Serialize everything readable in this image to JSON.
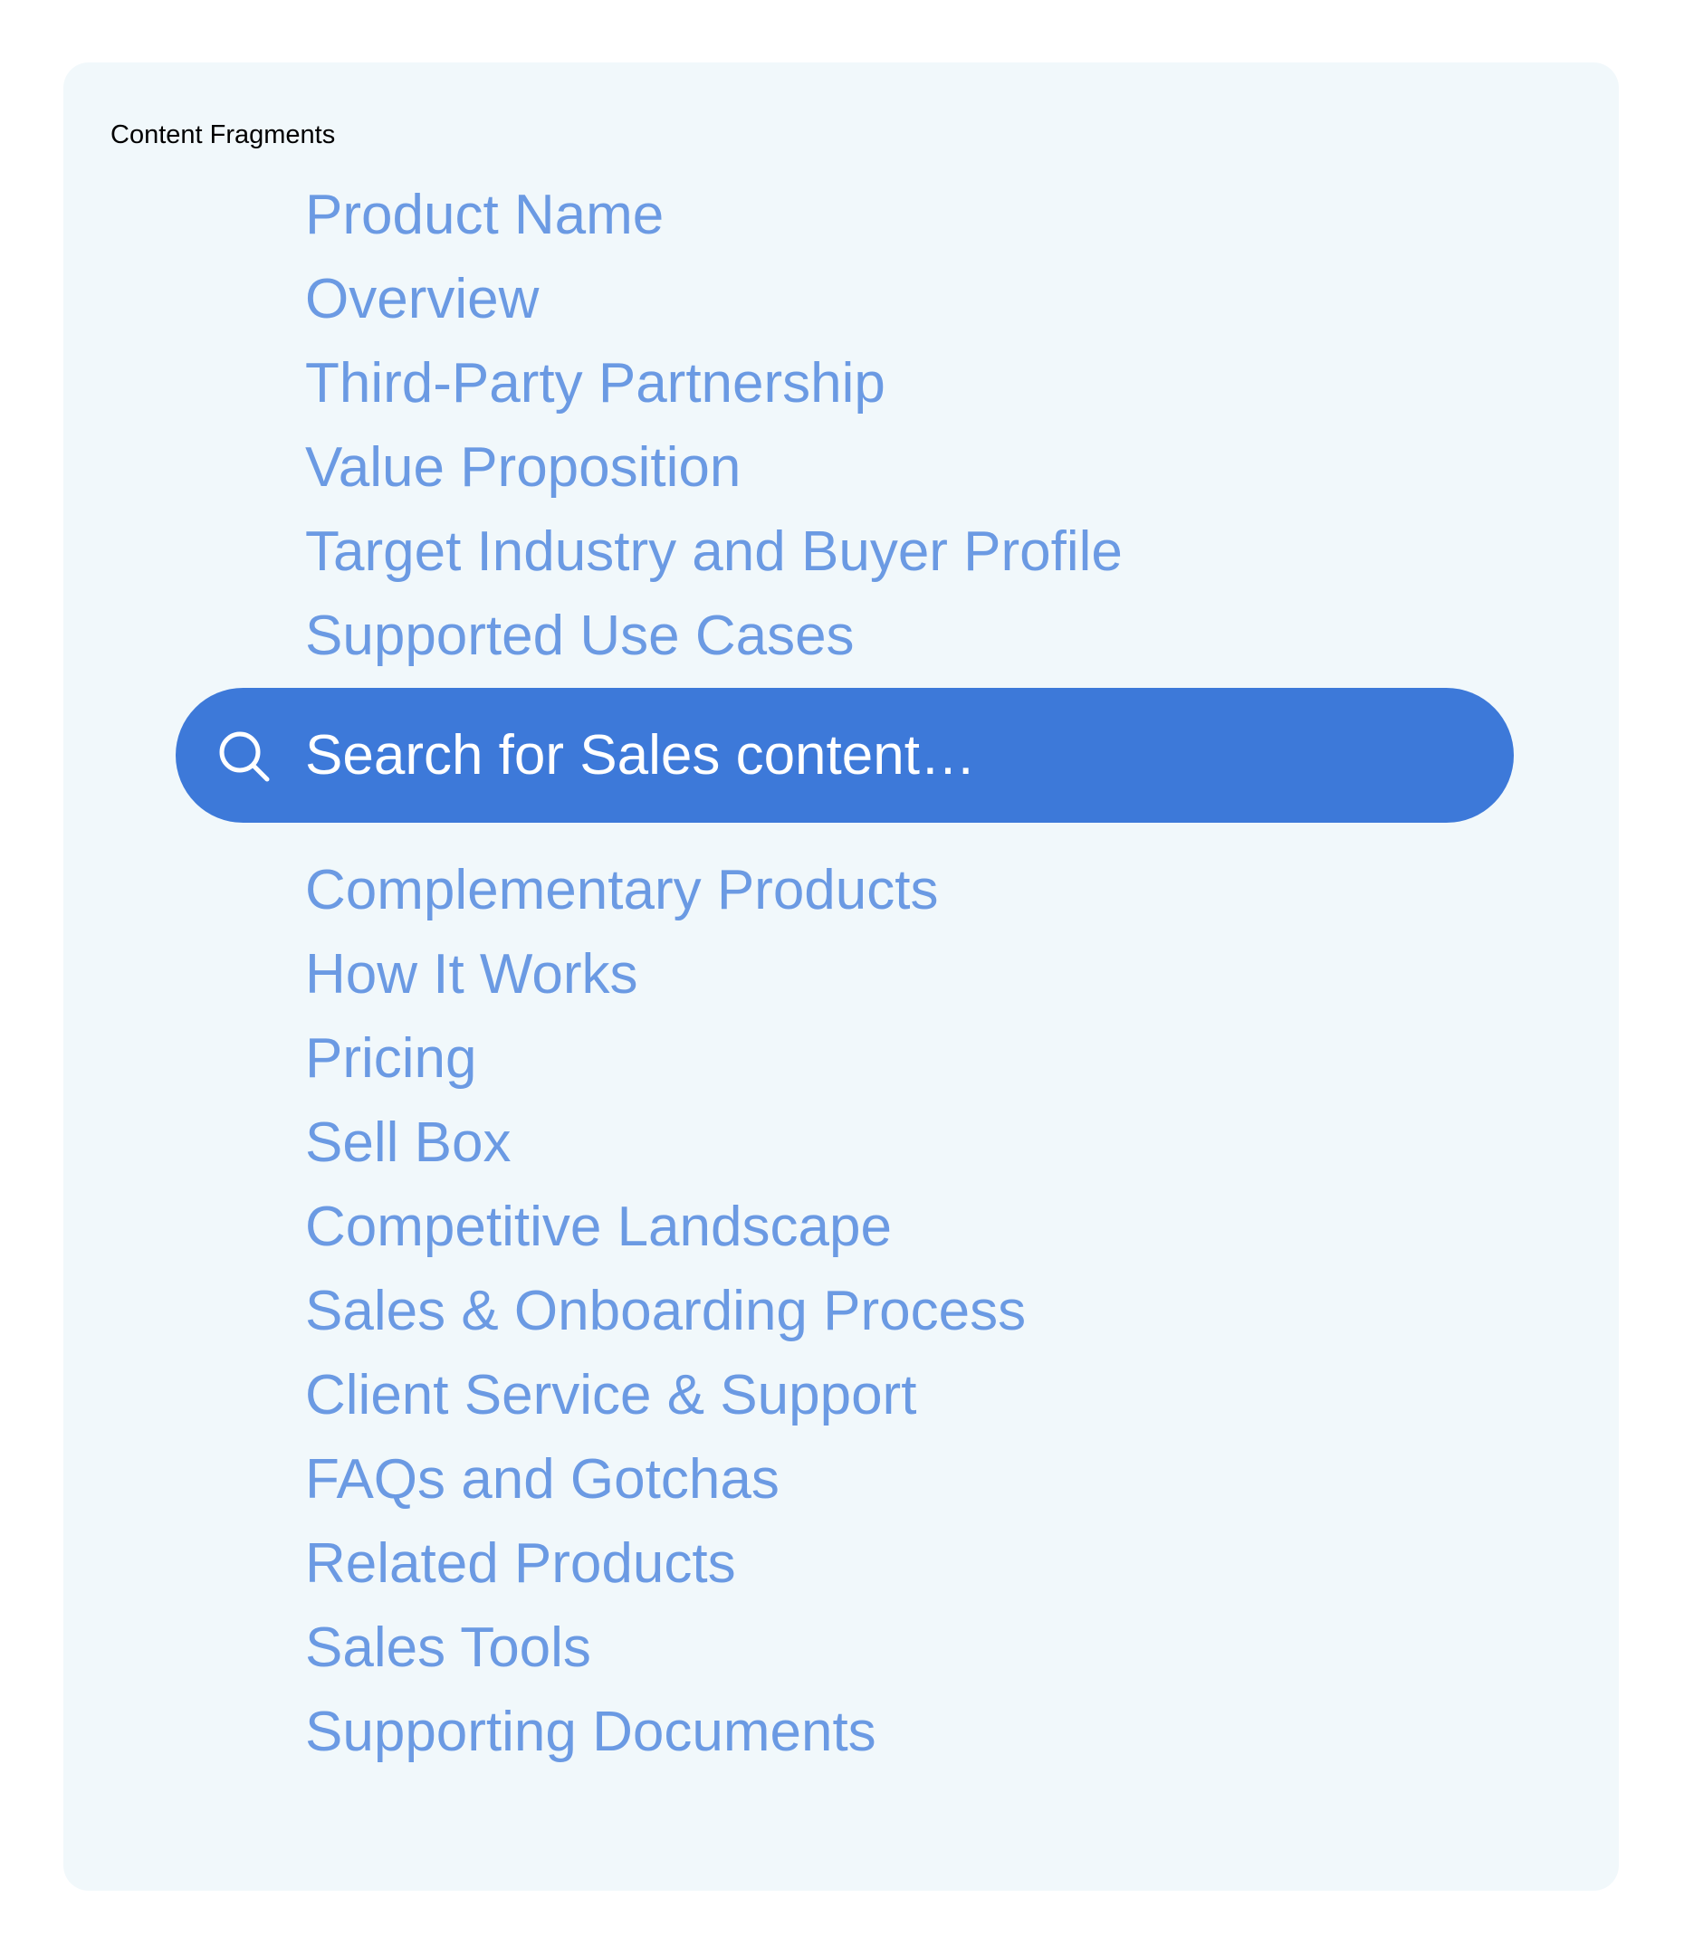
{
  "panel": {
    "title": "Content Fragments"
  },
  "fragments_top": [
    "Product Name",
    "Overview",
    "Third-Party Partnership",
    "Value Proposition",
    "Target Industry and Buyer Profile",
    "Supported Use Cases"
  ],
  "search": {
    "placeholder": "Search for Sales content…",
    "value": "",
    "icon": "search-icon"
  },
  "fragments_bottom": [
    "Complementary Products",
    "How It Works",
    "Pricing",
    "Sell Box",
    "Competitive Landscape",
    "Sales & Onboarding Process",
    "Client Service & Support",
    "FAQs and Gotchas",
    "Related Products",
    "Sales Tools",
    "Supporting Documents"
  ],
  "colors": {
    "panel_background": "#f1f8fb",
    "link": "#6b9ae3",
    "search_background": "#3d79d9",
    "search_text": "#ffffff"
  }
}
